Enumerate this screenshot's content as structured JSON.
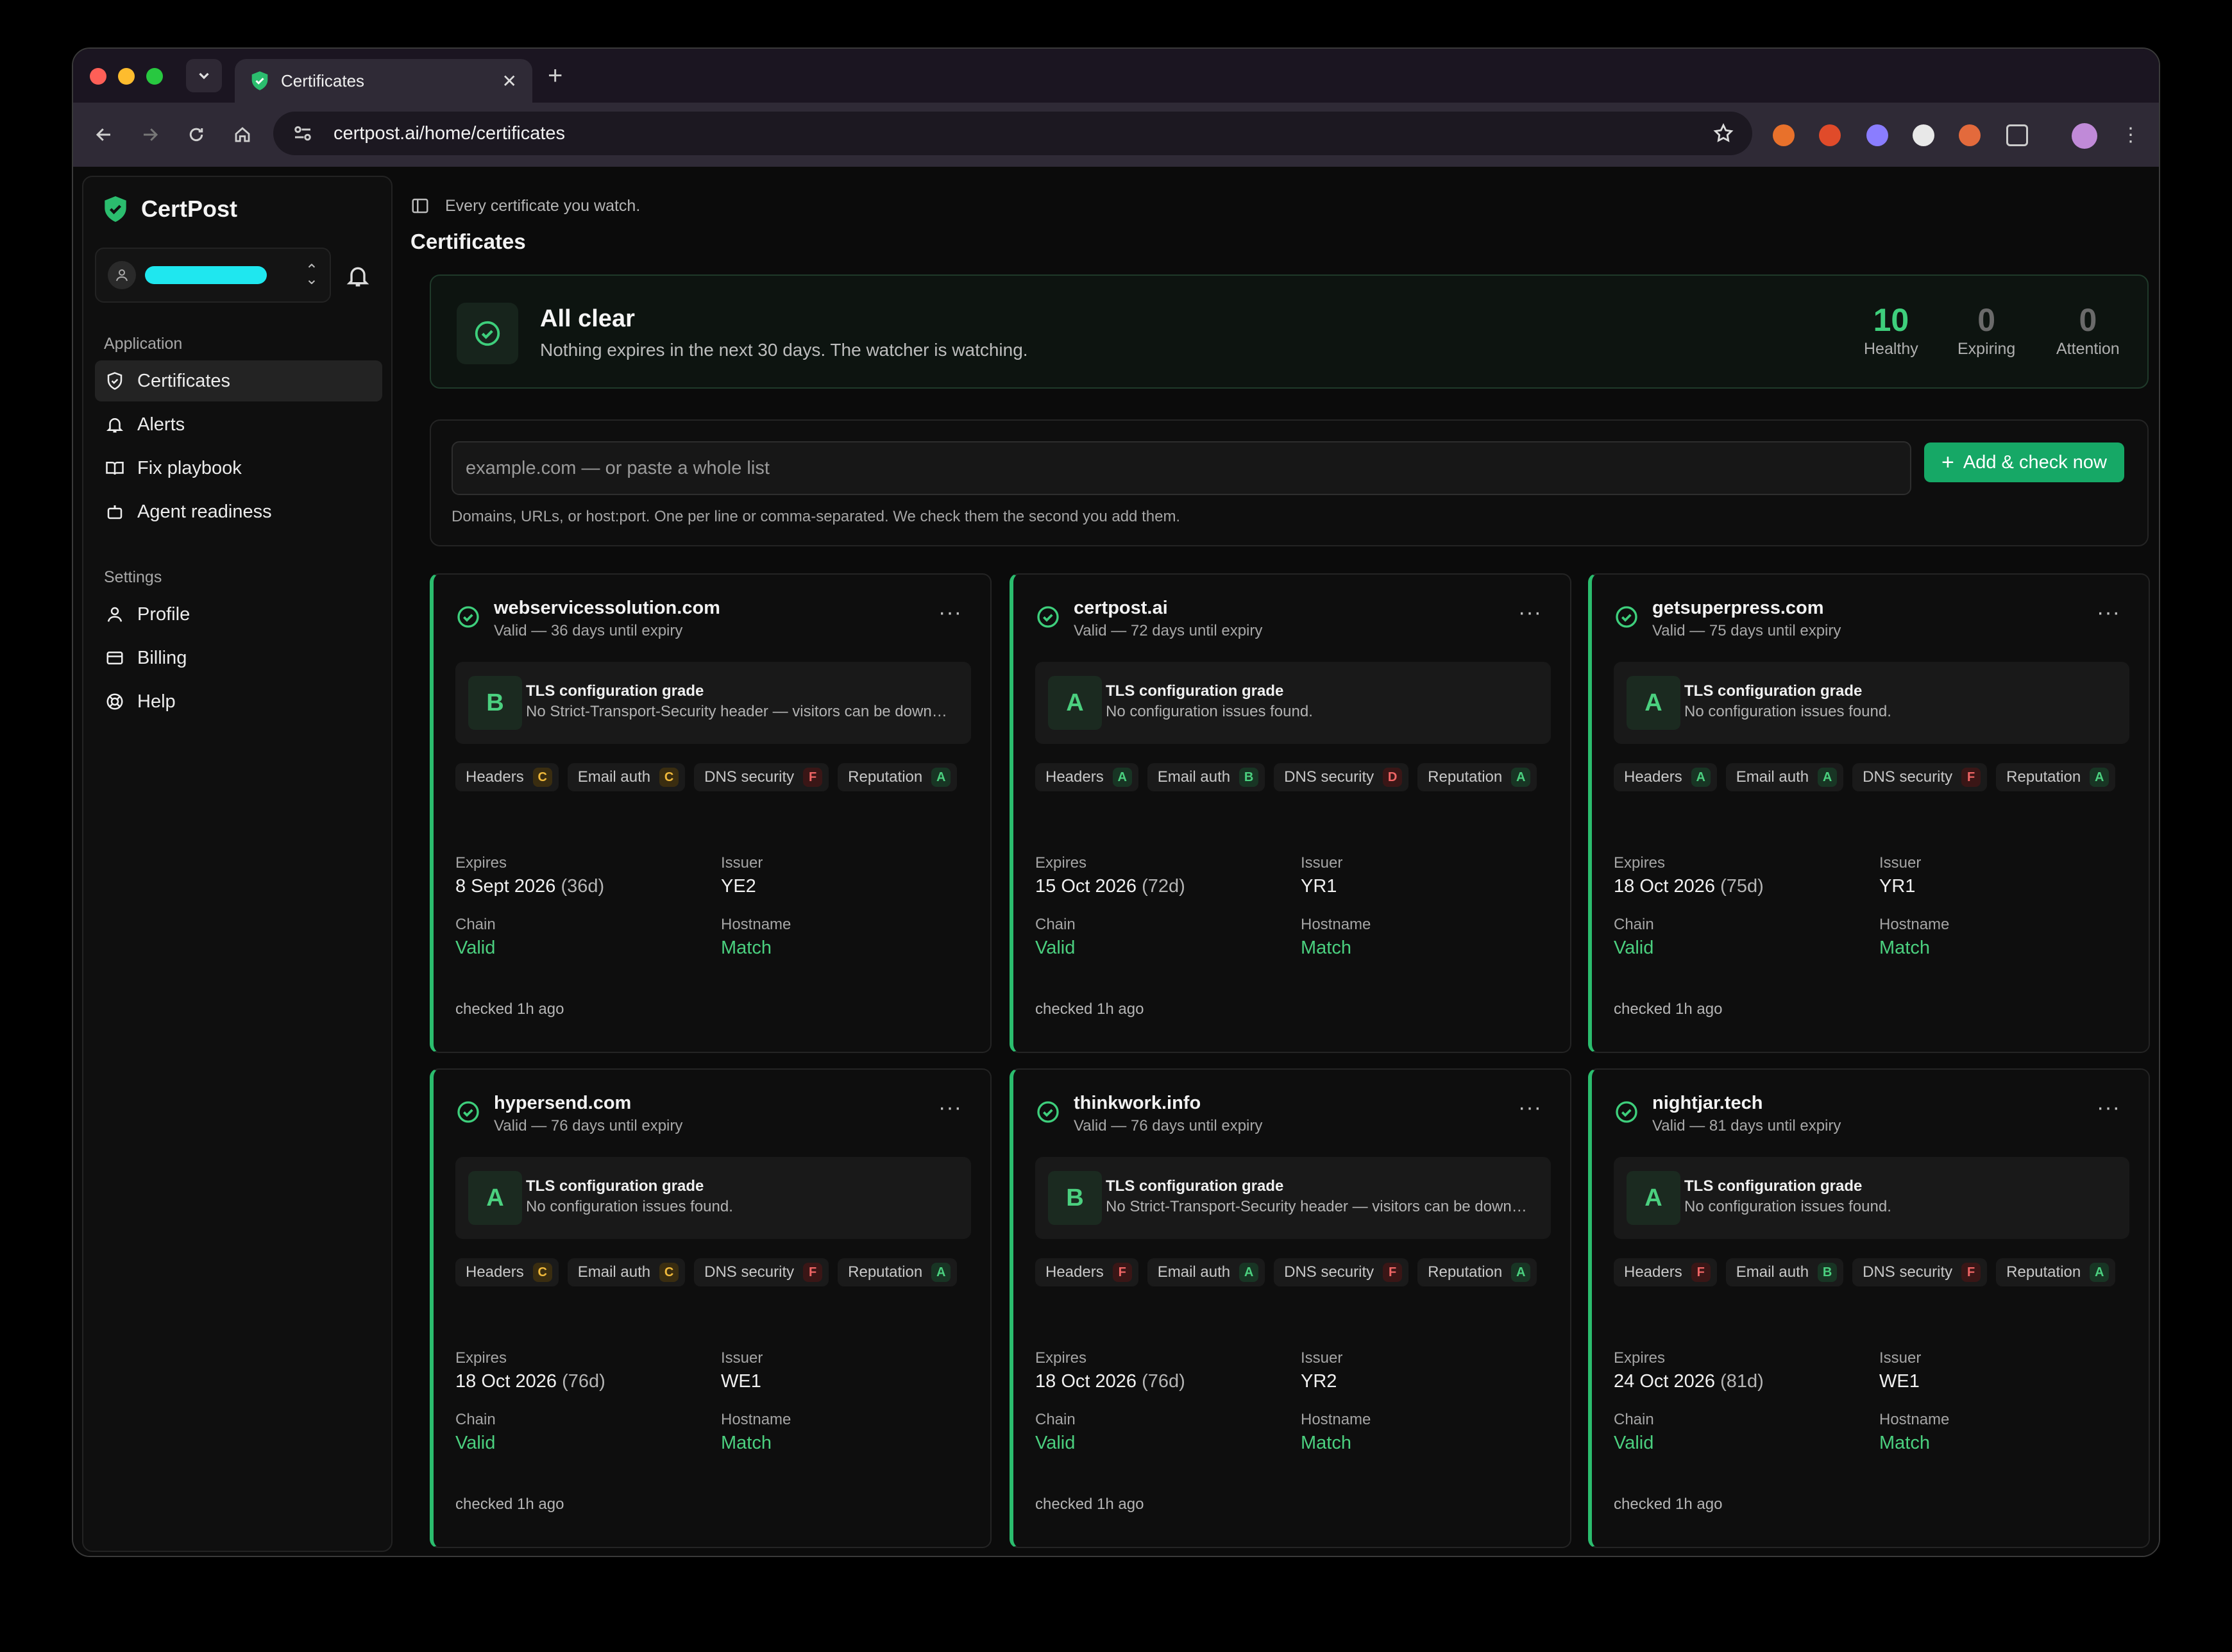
{
  "browser": {
    "tab_title": "Certificates",
    "url": "certpost.ai/home/certificates"
  },
  "sidebar": {
    "brand": "CertPost",
    "application_label": "Application",
    "items": [
      {
        "label": "Certificates",
        "icon": "shield-check-icon",
        "active": true
      },
      {
        "label": "Alerts",
        "icon": "bell-icon"
      },
      {
        "label": "Fix playbook",
        "icon": "book-open-icon"
      },
      {
        "label": "Agent readiness",
        "icon": "bot-icon"
      }
    ],
    "settings_label": "Settings",
    "settings_items": [
      {
        "label": "Profile",
        "icon": "user-icon"
      },
      {
        "label": "Billing",
        "icon": "credit-card-icon"
      },
      {
        "label": "Help",
        "icon": "lifebuoy-icon"
      }
    ]
  },
  "header": {
    "crumb": "Every certificate you watch.",
    "title": "Certificates"
  },
  "status": {
    "title": "All clear",
    "subtitle": "Nothing expires in the next 30 days. The watcher is watching.",
    "stats": [
      {
        "value": "10",
        "label": "Healthy",
        "color": "#3ecf7c"
      },
      {
        "value": "0",
        "label": "Expiring",
        "color": "#6a6a6a"
      },
      {
        "value": "0",
        "label": "Attention",
        "color": "#6a6a6a"
      }
    ]
  },
  "add": {
    "placeholder": "example.com — or paste a whole list",
    "button": "Add & check now",
    "help": "Domains, URLs, or host:port. One per line or comma-separated. We check them the second you add them."
  },
  "labels": {
    "grade_title": "TLS configuration grade",
    "expires": "Expires",
    "issuer": "Issuer",
    "chain": "Chain",
    "hostname": "Hostname",
    "headers": "Headers",
    "email_auth": "Email auth",
    "dns_security": "DNS security",
    "reputation": "Reputation"
  },
  "certificates": [
    {
      "domain": "webservicessolution.com",
      "status": "Valid — 36 days until expiry",
      "grade": "B",
      "grade_desc": "No Strict-Transport-Security header — visitors can be downgraded to HTTP",
      "headers": "C",
      "email_auth": "C",
      "dns_security": "F",
      "reputation": "A",
      "expires": "8 Sept 2026",
      "days": "(36d)",
      "issuer": "YE2",
      "chain": "Valid",
      "hostname": "Match",
      "checked": "checked 1h ago"
    },
    {
      "domain": "certpost.ai",
      "status": "Valid — 72 days until expiry",
      "grade": "A",
      "grade_desc": "No configuration issues found.",
      "headers": "A",
      "email_auth": "B",
      "dns_security": "D",
      "reputation": "A",
      "expires": "15 Oct 2026",
      "days": "(72d)",
      "issuer": "YR1",
      "chain": "Valid",
      "hostname": "Match",
      "checked": "checked 1h ago"
    },
    {
      "domain": "getsuperpress.com",
      "status": "Valid — 75 days until expiry",
      "grade": "A",
      "grade_desc": "No configuration issues found.",
      "headers": "A",
      "email_auth": "A",
      "dns_security": "F",
      "reputation": "A",
      "expires": "18 Oct 2026",
      "days": "(75d)",
      "issuer": "YR1",
      "chain": "Valid",
      "hostname": "Match",
      "checked": "checked 1h ago"
    },
    {
      "domain": "hypersend.com",
      "status": "Valid — 76 days until expiry",
      "grade": "A",
      "grade_desc": "No configuration issues found.",
      "headers": "C",
      "email_auth": "C",
      "dns_security": "F",
      "reputation": "A",
      "expires": "18 Oct 2026",
      "days": "(76d)",
      "issuer": "WE1",
      "chain": "Valid",
      "hostname": "Match",
      "checked": "checked 1h ago"
    },
    {
      "domain": "thinkwork.info",
      "status": "Valid — 76 days until expiry",
      "grade": "B",
      "grade_desc": "No Strict-Transport-Security header — visitors can be downgraded to HTTP",
      "headers": "F",
      "email_auth": "A",
      "dns_security": "F",
      "reputation": "A",
      "expires": "18 Oct 2026",
      "days": "(76d)",
      "issuer": "YR2",
      "chain": "Valid",
      "hostname": "Match",
      "checked": "checked 1h ago"
    },
    {
      "domain": "nightjar.tech",
      "status": "Valid — 81 days until expiry",
      "grade": "A",
      "grade_desc": "No configuration issues found.",
      "headers": "F",
      "email_auth": "B",
      "dns_security": "F",
      "reputation": "A",
      "expires": "24 Oct 2026",
      "days": "(81d)",
      "issuer": "WE1",
      "chain": "Valid",
      "hostname": "Match",
      "checked": "checked 1h ago"
    }
  ]
}
